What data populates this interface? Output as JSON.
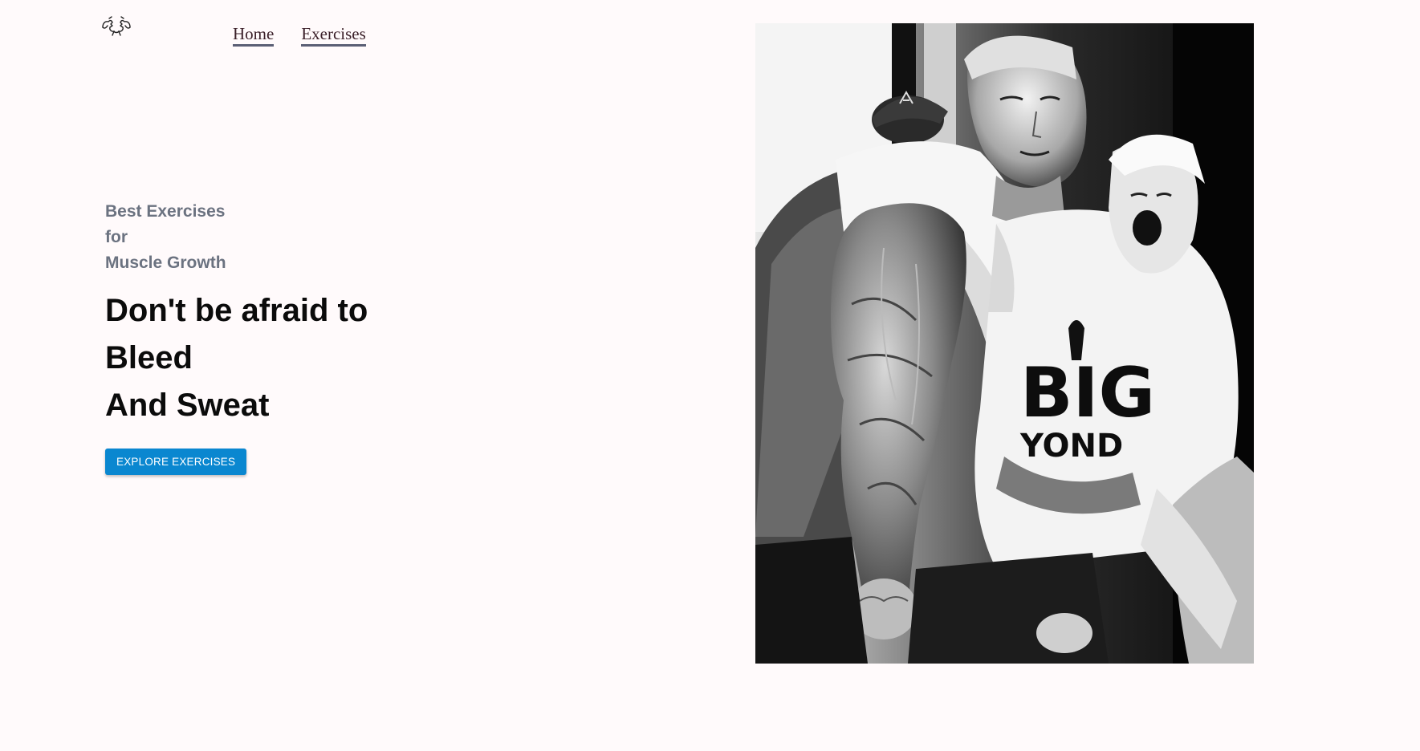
{
  "nav": {
    "logo_icon": "flexing-arms-icon",
    "items": [
      {
        "label": "Home"
      },
      {
        "label": "Exercises"
      }
    ]
  },
  "hero": {
    "subtitle_lines": [
      "Best Exercises",
      "for",
      "Muscle Growth"
    ],
    "headline_lines": [
      "Don't be afraid to",
      "Bleed",
      "And Sweat"
    ],
    "cta_label": "EXPLORE EXERCISES"
  },
  "banner": {
    "shirt_text": [
      "BIG",
      "YOND"
    ]
  },
  "colors": {
    "background": "#fffafb",
    "accent": "#0a87d0",
    "subtitle": "#6b7280",
    "headline": "#0b0b0b",
    "nav_text": "#3a1f28",
    "nav_underline": "#5b5f75"
  }
}
